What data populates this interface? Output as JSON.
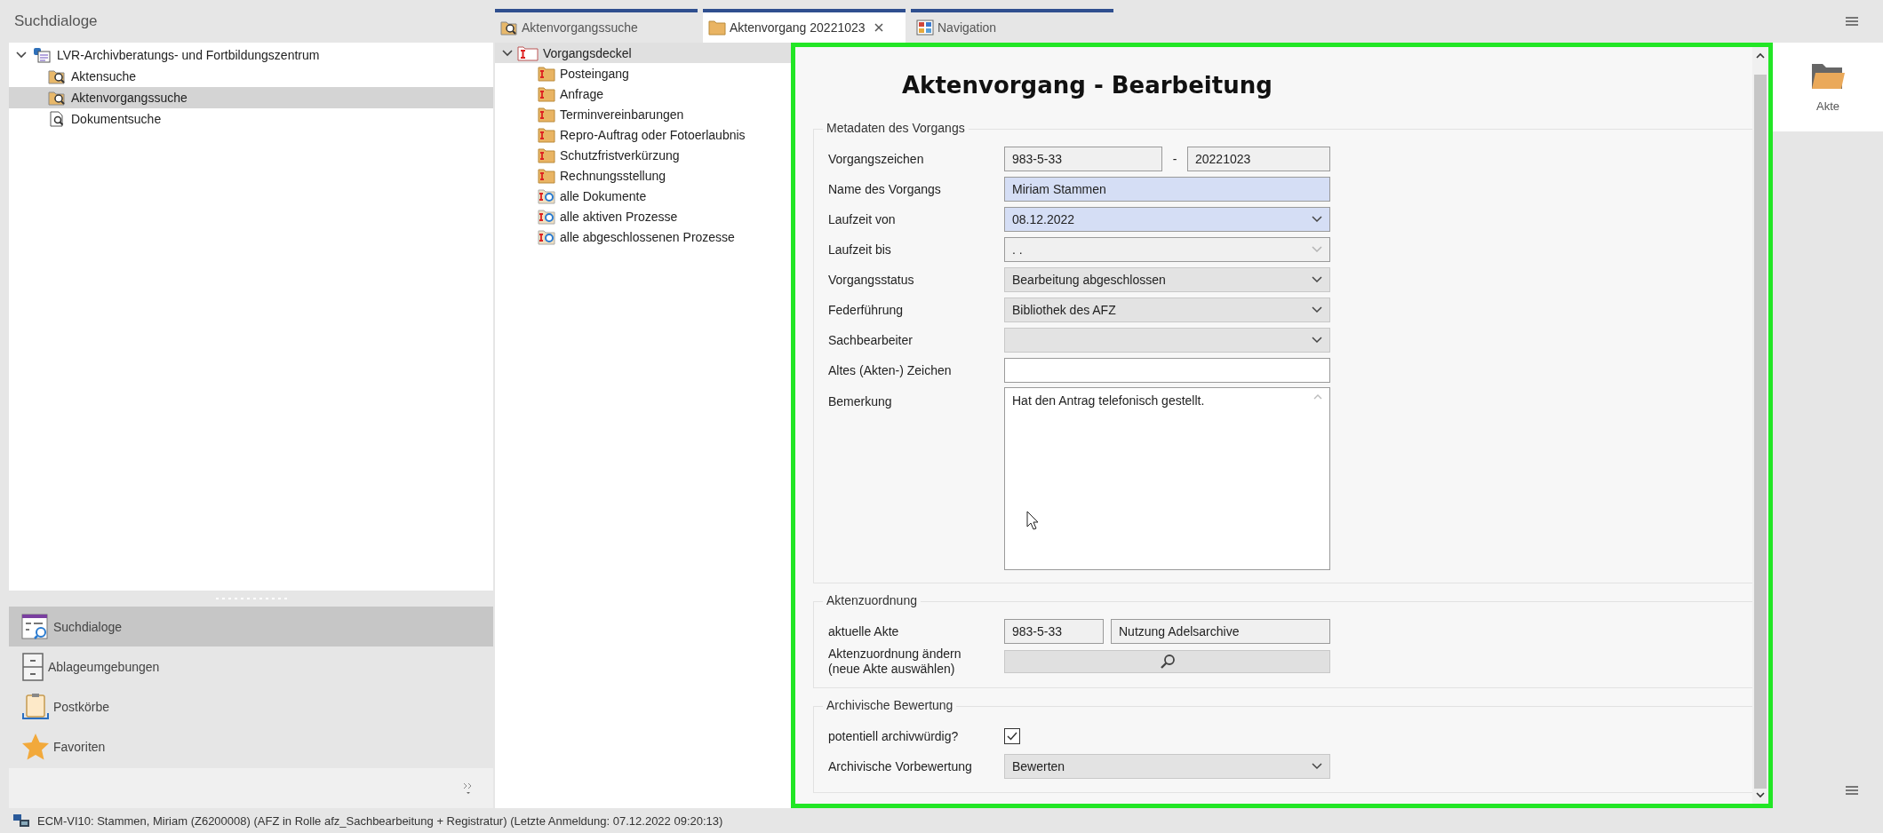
{
  "left_panel": {
    "title": "Suchdialoge",
    "tree": [
      {
        "label": "LVR-Archivberatungs- und Fortbildungszentrum",
        "kind": "org",
        "expanded": true,
        "selected": false,
        "children": [
          {
            "label": "Aktensuche",
            "kind": "folder-search",
            "selected": false
          },
          {
            "label": "Aktenvorgangssuche",
            "kind": "folder-search",
            "selected": true
          },
          {
            "label": "Dokumentsuche",
            "kind": "doc-search",
            "selected": false
          }
        ]
      }
    ],
    "nav": [
      {
        "label": "Suchdialoge",
        "kind": "search-dialog",
        "selected": true
      },
      {
        "label": "Ablageumgebungen",
        "kind": "cabinet",
        "selected": false
      },
      {
        "label": "Postkörbe",
        "kind": "clipboard",
        "selected": false
      },
      {
        "label": "Favoriten",
        "kind": "star",
        "selected": false
      }
    ]
  },
  "tabs": [
    {
      "label": "Aktenvorgangssuche",
      "kind": "search",
      "selected": false,
      "closable": false
    },
    {
      "label": "Aktenvorgang 20221023",
      "kind": "folder",
      "selected": true,
      "closable": true
    },
    {
      "label": "Navigation",
      "kind": "grid",
      "selected": false,
      "closable": false
    }
  ],
  "process_tree": [
    {
      "label": "Vorgangsdeckel",
      "kind": "cover",
      "expanded": true,
      "selected": true,
      "children": [
        {
          "label": "Posteingang",
          "kind": "folder",
          "selected": false
        },
        {
          "label": "Anfrage",
          "kind": "folder",
          "selected": false
        },
        {
          "label": "Terminvereinbarungen",
          "kind": "folder",
          "selected": false
        },
        {
          "label": "Repro-Auftrag oder Fotoerlaubnis",
          "kind": "folder",
          "selected": false
        },
        {
          "label": "Schutzfristverkürzung",
          "kind": "folder",
          "selected": false
        },
        {
          "label": "Rechnungsstellung",
          "kind": "folder",
          "selected": false
        },
        {
          "label": "alle Dokumente",
          "kind": "query",
          "selected": false
        },
        {
          "label": "alle aktiven Prozesse",
          "kind": "query",
          "selected": false
        },
        {
          "label": "alle abgeschlossenen Prozesse",
          "kind": "query",
          "selected": false
        }
      ]
    }
  ],
  "form": {
    "title": "Aktenvorgang - Bearbeitung",
    "highlighted": true,
    "groups": [
      {
        "title": "Metadaten des Vorgangs",
        "fields": [
          {
            "label": "Vorgangszeichen",
            "kind": "split",
            "readonly": true,
            "values": [
              "983-5-33",
              "20221023"
            ],
            "separator": "-"
          },
          {
            "label": "Name des Vorgangs",
            "kind": "text",
            "required": true,
            "value": "Miriam Stammen"
          },
          {
            "label": "Laufzeit von",
            "kind": "combo",
            "required": true,
            "value": "08.12.2022",
            "disabled": false
          },
          {
            "label": "Laufzeit bis",
            "kind": "combo",
            "required": false,
            "value": ". .",
            "disabled": true
          },
          {
            "label": "Vorgangsstatus",
            "kind": "combo",
            "required": false,
            "value": "Bearbeitung abgeschlossen",
            "disabled": false
          },
          {
            "label": "Federführung",
            "kind": "combo",
            "required": false,
            "value": "Bibliothek des AFZ",
            "disabled": false
          },
          {
            "label": "Sachbearbeiter",
            "kind": "combo",
            "required": false,
            "disabled": false
          },
          {
            "label": "Altes (Akten-) Zeichen",
            "kind": "text",
            "readonly": false,
            "required": false
          },
          {
            "label": "Bemerkung",
            "kind": "textarea",
            "value": "Hat den Antrag telefonisch gestellt."
          }
        ]
      },
      {
        "title": "Aktenzuordnung",
        "fields": [
          {
            "label": "aktuelle Akte",
            "kind": "split",
            "readonly": true,
            "values": [
              "983-5-33",
              "Nutzung Adelsarchive"
            ]
          },
          {
            "label": "Aktenzuordnung ändern\n(neue Akte auswählen)",
            "kind": "search"
          }
        ]
      },
      {
        "title": "Archivische Bewertung",
        "fields": [
          {
            "label": "potentiell archivwürdig?",
            "kind": "checkbox",
            "checked": true
          },
          {
            "label": "Archivische Vorbewertung",
            "kind": "combo",
            "required": false,
            "value": "Bewerten",
            "disabled": false
          }
        ]
      }
    ]
  },
  "right_panel": {
    "label": "Akte"
  },
  "status_bar": {
    "text": "ECM-VI10: Stammen, Miriam (Z6200008) (AFZ in Rolle afz_Sachbearbeitung + Registratur) (Letzte Anmeldung: 07.12.2022 09:20:13)"
  }
}
